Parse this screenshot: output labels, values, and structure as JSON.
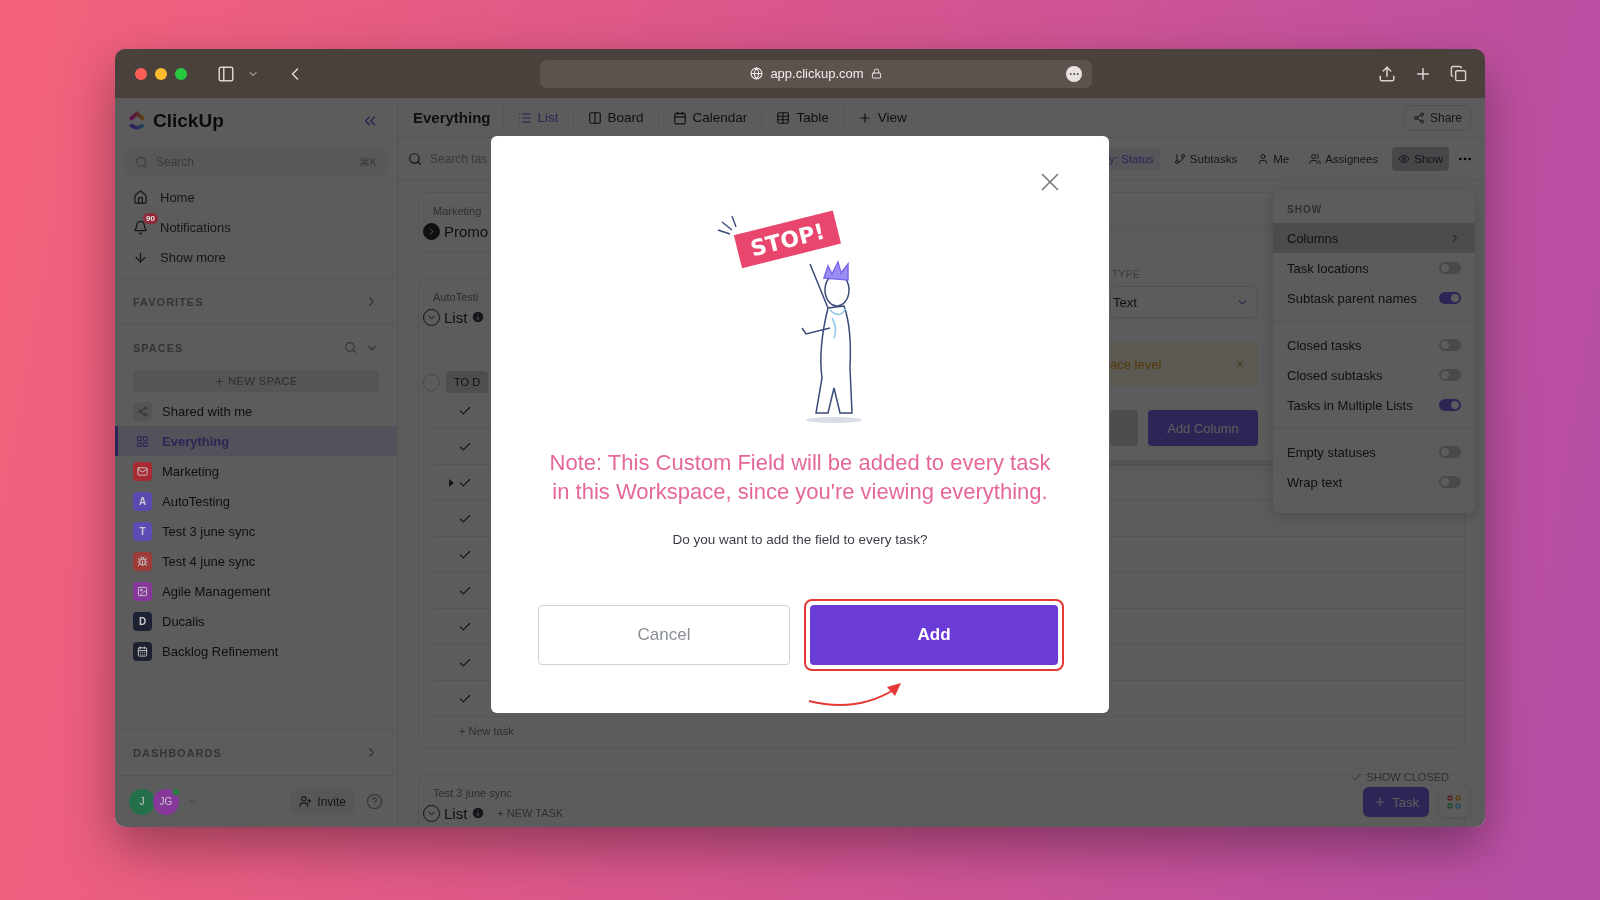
{
  "browser": {
    "url": "app.clickup.com"
  },
  "sidebar": {
    "brand": "ClickUp",
    "search": {
      "placeholder": "Search",
      "shortcut": "⌘K"
    },
    "nav": [
      {
        "label": "Home"
      },
      {
        "label": "Notifications",
        "badge": "90"
      },
      {
        "label": "Show more"
      }
    ],
    "favorites": "FAVORITES",
    "spaces_heading": "SPACES",
    "new_space": "NEW SPACE",
    "spaces": [
      {
        "label": "Shared with me",
        "kind": "shared",
        "selected": false
      },
      {
        "label": "Everything",
        "kind": "everything",
        "selected": true
      },
      {
        "label": "Marketing",
        "kind": "icon",
        "color": "#a82a33",
        "selected": false
      },
      {
        "label": "AutoTesting",
        "kind": "letter",
        "letter": "A",
        "color": "#5a4ab0",
        "selected": false
      },
      {
        "label": "Test 3 june sync",
        "kind": "letter",
        "letter": "T",
        "color": "#5d4cb6",
        "selected": false
      },
      {
        "label": "Test 4 june sync",
        "kind": "icon",
        "color": "#9c3a38",
        "selected": false
      },
      {
        "label": "Agile Management",
        "kind": "icon",
        "color": "#86389a",
        "selected": false
      },
      {
        "label": "Ducalis",
        "kind": "letter",
        "letter": "D",
        "color": "#1c2233",
        "selected": false
      },
      {
        "label": "Backlog Refinement",
        "kind": "icon",
        "color": "#1e2230",
        "selected": false
      }
    ],
    "dashboards": "DASHBOARDS",
    "user": {
      "avatars": [
        {
          "initials": "J",
          "color": "#24704a"
        },
        {
          "initials": "JG",
          "color": "#86379a"
        }
      ],
      "invite": "Invite"
    }
  },
  "main": {
    "title": "Everything",
    "views": [
      {
        "label": "List",
        "selected": true
      },
      {
        "label": "Board",
        "selected": false
      },
      {
        "label": "Calendar",
        "selected": false
      },
      {
        "label": "Table",
        "selected": false
      }
    ],
    "add_view": "View",
    "share": "Share",
    "toolbar": {
      "search_placeholder": "Search tas",
      "group_by": "y: Status",
      "filters": [
        {
          "label": "Subtasks",
          "selected": false
        },
        {
          "label": "Me",
          "selected": false
        },
        {
          "label": "Assignees",
          "selected": false
        },
        {
          "label": "Show",
          "selected": true
        }
      ]
    },
    "groups": [
      {
        "location": "Marketing",
        "title": "Promo",
        "expanded": false
      },
      {
        "location": "AutoTesti",
        "title": "List",
        "expanded": true,
        "status": "TO D",
        "tasks": [
          {
            "expandable": false
          },
          {
            "expandable": false
          },
          {
            "expandable": true
          },
          {
            "expandable": false
          },
          {
            "expandable": false
          },
          {
            "expandable": false
          },
          {
            "expandable": false
          },
          {
            "expandable": false
          },
          {
            "expandable": false
          }
        ],
        "new_task": "+ New task"
      },
      {
        "location": "Test 3 june sync",
        "title": "List",
        "expanded": true,
        "new_task": "+ NEW TASK"
      }
    ],
    "add_column": {
      "type_label": "TYPE",
      "type_value": "Text",
      "warning": "ace level",
      "submit": "Add Column"
    },
    "show_menu": {
      "heading": "SHOW",
      "groups": [
        {
          "items": [
            {
              "label": "Columns",
              "kind": "submenu",
              "selected": true
            },
            {
              "label": "Task locations",
              "kind": "toggle",
              "on": false,
              "selected": false
            },
            {
              "label": "Subtask parent names",
              "kind": "toggle",
              "on": true,
              "selected": false
            }
          ]
        },
        {
          "items": [
            {
              "label": "Closed tasks",
              "kind": "toggle",
              "on": false,
              "selected": false
            },
            {
              "label": "Closed subtasks",
              "kind": "toggle",
              "on": false,
              "selected": false
            },
            {
              "label": "Tasks in Multiple Lists",
              "kind": "toggle",
              "on": true,
              "selected": false
            }
          ]
        },
        {
          "items": [
            {
              "label": "Empty statuses",
              "kind": "toggle",
              "on": false,
              "selected": false
            },
            {
              "label": "Wrap text",
              "kind": "toggle",
              "on": false,
              "selected": false
            }
          ]
        }
      ]
    },
    "show_closed": "SHOW CLOSED",
    "add_task": "Task"
  },
  "modal": {
    "sign_text": "STOP!",
    "note": "Note: This Custom Field will be added to every task\nin this Workspace, since you're viewing everything.",
    "question": "Do you want to add the field to every task?",
    "cancel": "Cancel",
    "confirm": "Add",
    "confirm_highlighted": true
  }
}
